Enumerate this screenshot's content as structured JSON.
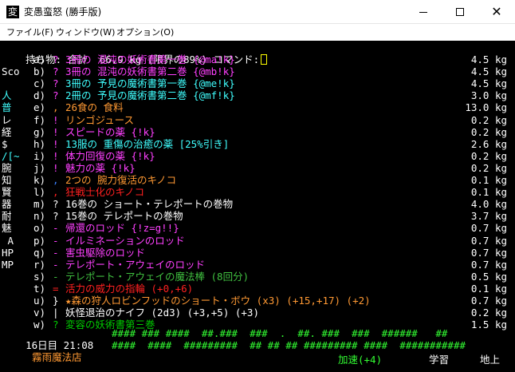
{
  "window": {
    "icon_glyph": "変",
    "title": "変愚蛮怒 (勝手版)"
  },
  "menu": [
    "ファイル(F)",
    "ウィンドウ(W)",
    "オプション(O)"
  ],
  "header": {
    "label": "持ち物: 合計  66.9 kg (限界の89%) コマンド:"
  },
  "sidebar": [
    {
      "text": "",
      "color": "w"
    },
    {
      "text": "Sco",
      "color": "w"
    },
    {
      "text": "",
      "color": "w"
    },
    {
      "text": "人",
      "color": "c"
    },
    {
      "text": "普",
      "color": "c"
    },
    {
      "text": "レ",
      "color": "w"
    },
    {
      "text": "経",
      "color": "w"
    },
    {
      "text": "$",
      "color": "w"
    },
    {
      "text": "/[~",
      "color": "c"
    },
    {
      "text": "腕",
      "color": "w"
    },
    {
      "text": "知",
      "color": "w"
    },
    {
      "text": "賢",
      "color": "w"
    },
    {
      "text": "器",
      "color": "w"
    },
    {
      "text": "耐",
      "color": "w"
    },
    {
      "text": "魅",
      "color": "w"
    },
    {
      "text": " A",
      "color": "w"
    },
    {
      "text": "HP",
      "color": "w"
    },
    {
      "text": "MP",
      "color": "w"
    }
  ],
  "items": [
    {
      "slot": "a)",
      "sym": "?",
      "sym_color": "m",
      "name": "3冊の 混沌の妖術書第一巻 {@ma!k}",
      "color": "m",
      "weight": "4.5 kg"
    },
    {
      "slot": "b)",
      "sym": "?",
      "sym_color": "m",
      "name": "3冊の 混沌の妖術書第二巻 {@mb!k}",
      "color": "m",
      "weight": "4.5 kg"
    },
    {
      "slot": "c)",
      "sym": "?",
      "sym_color": "m",
      "name": "3冊の 予見の魔術書第一巻 {@me!k}",
      "color": "c",
      "weight": "4.5 kg"
    },
    {
      "slot": "d)",
      "sym": "?",
      "sym_color": "m",
      "name": "2冊の 予見の魔術書第二巻 {@mf!k}",
      "color": "c",
      "weight": "3.0 kg"
    },
    {
      "slot": "e)",
      "sym": ",",
      "sym_color": "o",
      "name": "26食の 食料",
      "color": "o",
      "weight": "13.0 kg"
    },
    {
      "slot": "f)",
      "sym": "!",
      "sym_color": "m",
      "name": "リンゴジュース",
      "color": "o",
      "weight": "0.2 kg"
    },
    {
      "slot": "g)",
      "sym": "!",
      "sym_color": "m",
      "name": "スピードの薬 {!k}",
      "color": "m",
      "weight": "0.2 kg"
    },
    {
      "slot": "h)",
      "sym": "!",
      "sym_color": "m",
      "name": "13服の 重傷の治癒の薬 [25%引き]",
      "color": "c",
      "weight": "2.6 kg"
    },
    {
      "slot": "i)",
      "sym": "!",
      "sym_color": "m",
      "name": "体力回復の薬 {!k}",
      "color": "m",
      "weight": "0.2 kg"
    },
    {
      "slot": "j)",
      "sym": "!",
      "sym_color": "m",
      "name": "魅力の薬 {!k}",
      "color": "m",
      "weight": "0.2 kg"
    },
    {
      "slot": "k)",
      "sym": ",",
      "sym_color": "b",
      "name": "2つの 腕力復活のキノコ",
      "color": "o",
      "weight": "0.1 kg"
    },
    {
      "slot": "l)",
      "sym": ",",
      "sym_color": "r",
      "name": "狂戦士化のキノコ",
      "color": "r",
      "weight": "0.1 kg"
    },
    {
      "slot": "m)",
      "sym": "?",
      "sym_color": "w",
      "name": "16巻の ショート・テレポートの巻物",
      "color": "w",
      "weight": "4.0 kg"
    },
    {
      "slot": "n)",
      "sym": "?",
      "sym_color": "w",
      "name": "15巻の テレポートの巻物",
      "color": "w",
      "weight": "3.7 kg"
    },
    {
      "slot": "o)",
      "sym": "-",
      "sym_color": "m",
      "name": "帰還のロッド {!z=g!!}",
      "color": "m",
      "weight": "0.7 kg"
    },
    {
      "slot": "p)",
      "sym": "-",
      "sym_color": "m",
      "name": "イルミネーションのロッド",
      "color": "m",
      "weight": "0.7 kg"
    },
    {
      "slot": "q)",
      "sym": "-",
      "sym_color": "m",
      "name": "害虫駆除のロッド",
      "color": "m",
      "weight": "0.7 kg"
    },
    {
      "slot": "r)",
      "sym": "-",
      "sym_color": "m",
      "name": "テレポート・アウェイのロッド",
      "color": "m",
      "weight": "0.7 kg"
    },
    {
      "slot": "s)",
      "sym": "-",
      "sym_color": "dg",
      "name": "テレポート・アウェイの魔法棒 (8回分)",
      "color": "dg",
      "weight": "0.5 kg"
    },
    {
      "slot": "t)",
      "sym": "=",
      "sym_color": "r",
      "name": "活力の威力の指輪 (+0,+6)",
      "color": "r",
      "weight": "0.1 kg"
    },
    {
      "slot": "u)",
      "sym": "}",
      "sym_color": "w",
      "name": "★森の狩人ロビンフッドのショート・ボウ (x3) (+15,+17) (+2)",
      "color": "o",
      "weight": "0.7 kg"
    },
    {
      "slot": "v)",
      "sym": "|",
      "sym_color": "w",
      "name": "妖怪退治のナイフ (2d3) (+3,+5) (+3)",
      "color": "w",
      "weight": "0.2 kg"
    },
    {
      "slot": "w)",
      "sym": "?",
      "sym_color": "g",
      "name": "変容の妖術書第三巻",
      "color": "g",
      "weight": "1.5 kg"
    }
  ],
  "footer": {
    "time": "16日目 21:08",
    "location": "霧雨魔法店",
    "map_row1": "#### ### ####  ##.###  ###  .  ##. ###  ###  ######   ##",
    "map_row2": "####  ####  #########  ## ## ## ######### ####  ###########",
    "speed": "加速(+4)",
    "study": "学習",
    "depth": "地上"
  }
}
